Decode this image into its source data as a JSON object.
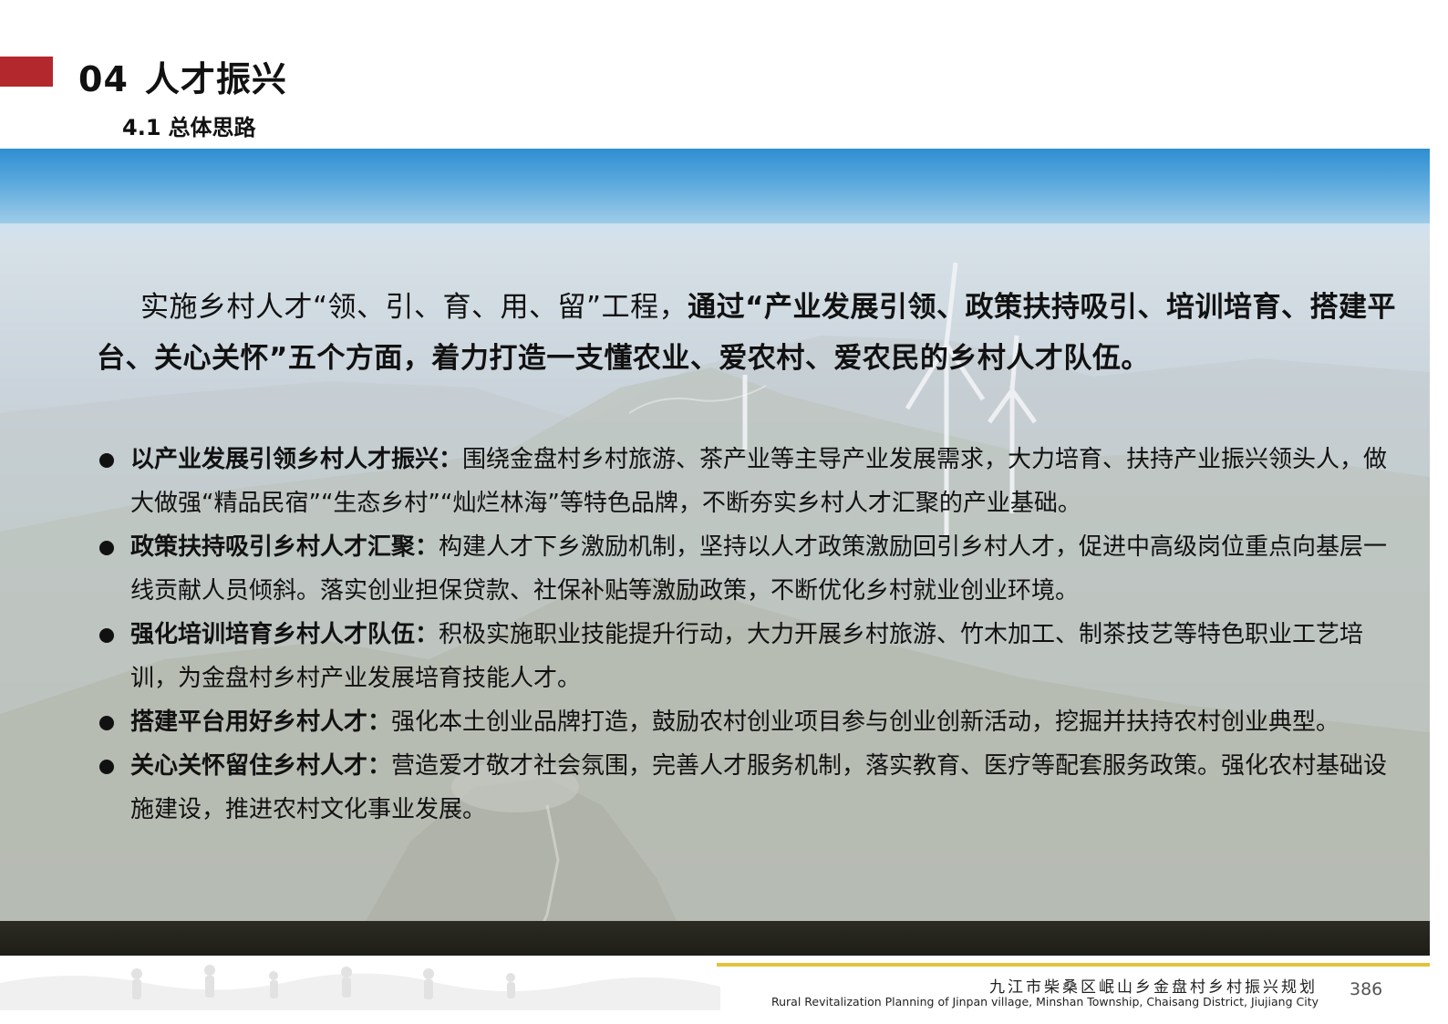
{
  "header": {
    "section_number": "04",
    "section_title": "人才振兴",
    "subsection_number": "4.1",
    "subsection_title": "总体思路"
  },
  "intro": {
    "normal": "实施乡村人才“领、引、育、用、留”工程，",
    "bold": "通过“产业发展引领、政策扶持吸引、培训培育、搭建平台、关心关怀”五个方面，着力打造一支懂农业、爱农村、爱农民的乡村人才队伍。"
  },
  "bullets": [
    {
      "lead": "以产业发展引领乡村人才振兴：",
      "text": "围绕金盘村乡村旅游、茶产业等主导产业发展需求，大力培育、扶持产业振兴领头人，做大做强“精品民宿”“生态乡村”“灿烂林海”等特色品牌，不断夯实乡村人才汇聚的产业基础。"
    },
    {
      "lead": "政策扶持吸引乡村人才汇聚：",
      "text": "构建人才下乡激励机制，坚持以人才政策激励回引乡村人才，促进中高级岗位重点向基层一线贡献人员倾斜。落实创业担保贷款、社保补贴等激励政策，不断优化乡村就业创业环境。"
    },
    {
      "lead": "强化培训培育乡村人才队伍：",
      "text": "积极实施职业技能提升行动，大力开展乡村旅游、竹木加工、制茶技艺等特色职业工艺培训，为金盘村乡村产业发展培育技能人才。"
    },
    {
      "lead": "搭建平台用好乡村人才：",
      "text": "强化本土创业品牌打造，鼓励农村创业项目参与创业创新活动，挖掘并扶持农村创业典型。"
    },
    {
      "lead": "关心关怀留住乡村人才：",
      "text": "营造爱才敬才社会氛围，完善人才服务机制，落实教育、医疗等配套服务政策。强化农村基础设施建设，推进农村文化事业发展。"
    }
  ],
  "footer": {
    "title_cn": "九江市柴桑区岷山乡金盘村乡村振兴规划",
    "title_en": "Rural Revitalization Planning of Jinpan village, Minshan Township, Chaisang District, Jiujiang City",
    "page_number": "386"
  },
  "colors": {
    "accent_red": "#b3282d",
    "footer_line_yellow": "#e2c33c",
    "sky_blue": "#3f9cd6"
  }
}
